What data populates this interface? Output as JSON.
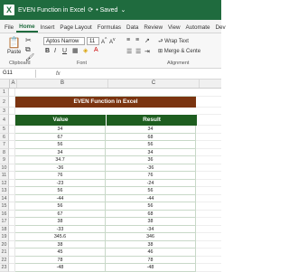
{
  "app": {
    "title": "EVEN Function in Excel",
    "saved_label": "Saved",
    "logo_letter": "X"
  },
  "ribbon": {
    "tabs": [
      "File",
      "Home",
      "Insert",
      "Page Layout",
      "Formulas",
      "Data",
      "Review",
      "View",
      "Automate",
      "Dev"
    ],
    "active_tab": "Home",
    "font_name": "Aptos Narrow",
    "font_size": "11",
    "paste_label": "Paste",
    "clipboard_label": "Clipboard",
    "font_label": "Font",
    "alignment_label": "Alignment",
    "wrap_text_label": "Wrap Text",
    "merge_label": "Merge & Cente"
  },
  "formula_bar": {
    "cell_ref": "G11",
    "fx": "fx"
  },
  "columns": [
    "A",
    "B",
    "C"
  ],
  "sheet": {
    "title": "EVEN Function in Excel",
    "headers": [
      "Value",
      "Result"
    ],
    "rows": [
      [
        "34",
        "34"
      ],
      [
        "67",
        "68"
      ],
      [
        "56",
        "56"
      ],
      [
        "34",
        "34"
      ],
      [
        "34.7",
        "36"
      ],
      [
        "-36",
        "-36"
      ],
      [
        "76",
        "76"
      ],
      [
        "-23",
        "-24"
      ],
      [
        "56",
        "56"
      ],
      [
        "-44",
        "-44"
      ],
      [
        "56",
        "56"
      ],
      [
        "67",
        "68"
      ],
      [
        "38",
        "38"
      ],
      [
        "-33",
        "-34"
      ],
      [
        "345.6",
        "346"
      ],
      [
        "38",
        "38"
      ],
      [
        "45",
        "46"
      ],
      [
        "78",
        "78"
      ],
      [
        "-48",
        "-48"
      ]
    ]
  }
}
